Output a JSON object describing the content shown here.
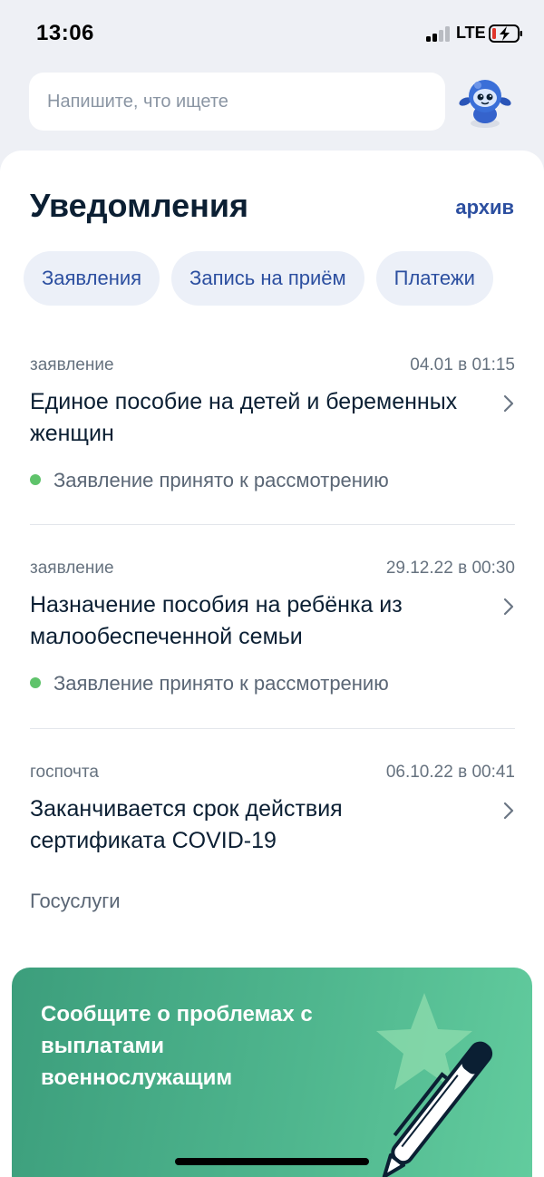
{
  "status_bar": {
    "time": "13:06",
    "network": "LTE"
  },
  "search": {
    "placeholder": "Напишите, что ищете"
  },
  "header": {
    "title": "Уведомления",
    "archive_label": "архив"
  },
  "filters": [
    {
      "label": "Заявления"
    },
    {
      "label": "Запись на приём"
    },
    {
      "label": "Платежи"
    }
  ],
  "notifications": [
    {
      "type": "заявление",
      "date": "04.01 в 01:15",
      "title": "Единое пособие на детей и беременных женщин",
      "status": "Заявление принято к рассмотрению"
    },
    {
      "type": "заявление",
      "date": "29.12.22 в 00:30",
      "title": "Назначение пособия на ребёнка из малообеспеченной семьи",
      "status": "Заявление принято к рассмотрению"
    },
    {
      "type": "госпочта",
      "date": "06.10.22 в 00:41",
      "title": "Заканчивается срок действия сертификата COVID-19",
      "source": "Госуслуги"
    }
  ],
  "banner": {
    "text": "Сообщите о проблемах с выплатами военнослужащим"
  },
  "colors": {
    "accent": "#2c4fa0",
    "status_ok": "#5fc36b",
    "banner": "#4fb68e"
  },
  "icons": [
    "signal-icon",
    "battery-charging-icon",
    "robot-assistant-icon",
    "chevron-right-icon",
    "star-icon",
    "pen-icon"
  ]
}
